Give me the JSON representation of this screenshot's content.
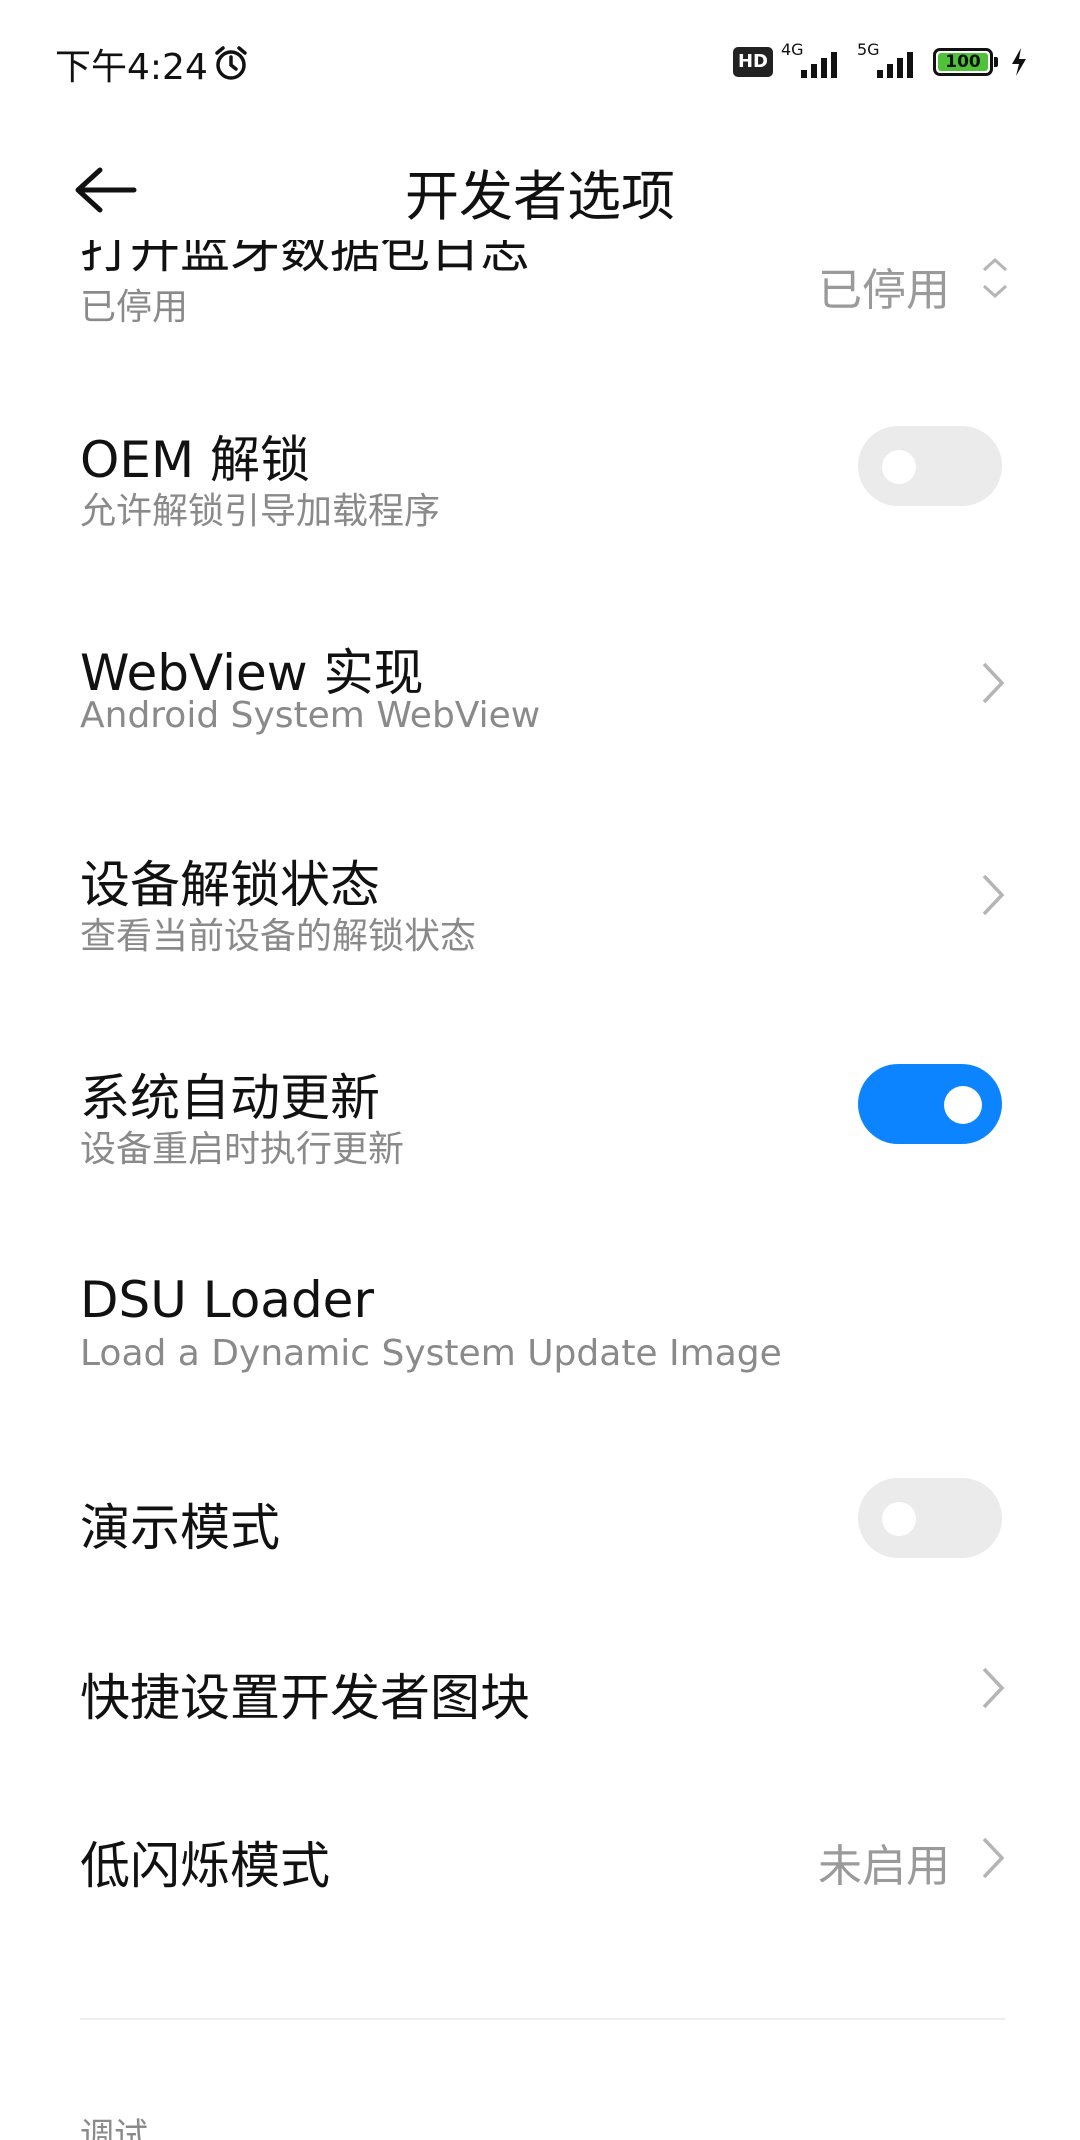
{
  "status_bar": {
    "time": "下午4:24",
    "hd_label": "HD",
    "net1": "4G",
    "net2": "5G",
    "battery": "100"
  },
  "header": {
    "title": "开发者选项"
  },
  "partial_row": {
    "title": "打开蓝牙数据包日志",
    "subtitle": "已停用",
    "value": "已停用"
  },
  "rows": [
    {
      "title": "OEM 解锁",
      "subtitle": "允许解锁引导加载程序",
      "control": "toggle",
      "on": false
    },
    {
      "title": "WebView 实现",
      "subtitle": "Android System WebView",
      "control": "chevron"
    },
    {
      "title": "设备解锁状态",
      "subtitle": "查看当前设备的解锁状态",
      "control": "chevron"
    },
    {
      "title": "系统自动更新",
      "subtitle": "设备重启时执行更新",
      "control": "toggle",
      "on": true
    },
    {
      "title": "DSU Loader",
      "subtitle": "Load a Dynamic System Update Image",
      "control": "none"
    },
    {
      "title": "演示模式",
      "control": "toggle",
      "on": false
    },
    {
      "title": "快捷设置开发者图块",
      "control": "chevron"
    },
    {
      "title": "低闪烁模式",
      "value": "未启用",
      "control": "chevron"
    }
  ],
  "section": {
    "title": "调试"
  },
  "colors": {
    "accent": "#0d84ff",
    "toggle_off": "#ebebeb",
    "battery": "#4fc23a"
  }
}
